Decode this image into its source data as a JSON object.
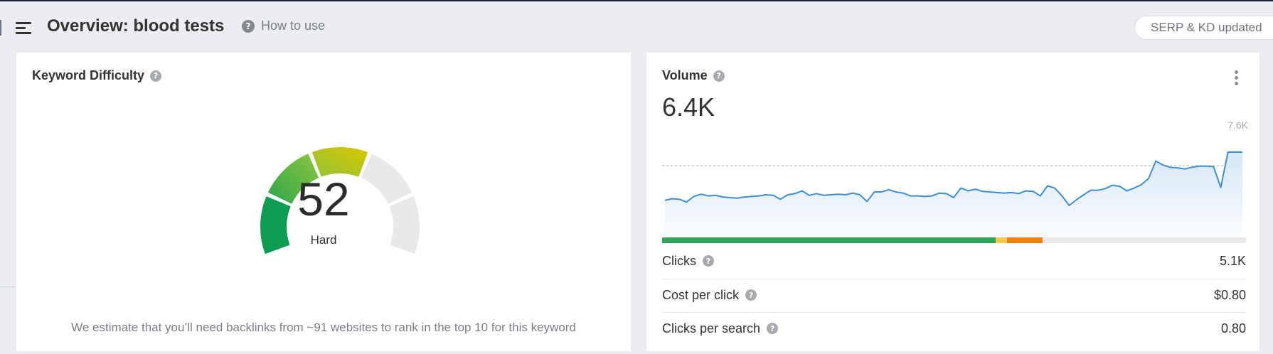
{
  "header": {
    "title": "Overview: blood tests",
    "how_to_use": "How to use",
    "serp_status": "SERP & KD updated"
  },
  "keyword_difficulty": {
    "title": "Keyword Difficulty",
    "value": "52",
    "label": "Hard",
    "note": "We estimate that you’ll need backlinks from ~91 websites to rank in the top 10 for this keyword",
    "colors": {
      "green_dark": "#0c9c52",
      "green": "#55b62f",
      "yellow": "#d8c100",
      "empty": "#e8e9eb"
    }
  },
  "volume": {
    "title": "Volume",
    "value": "6.4K",
    "y_max_label": "7.6K",
    "chart_data": {
      "type": "area",
      "title": "",
      "xlabel": "",
      "ylabel": "",
      "ylim": [
        0,
        7600
      ],
      "reference_line": 6400,
      "values": [
        3300,
        3450,
        3400,
        3150,
        3650,
        3850,
        3700,
        3750,
        3600,
        3550,
        3500,
        3600,
        3650,
        3700,
        3800,
        3750,
        3400,
        3800,
        3900,
        4150,
        3750,
        3900,
        3750,
        3800,
        3850,
        3800,
        3950,
        3800,
        3200,
        4050,
        4050,
        4250,
        4050,
        3950,
        3700,
        3700,
        3650,
        3700,
        3950,
        3900,
        3550,
        4400,
        4150,
        4300,
        4100,
        4050,
        4000,
        3950,
        4000,
        3900,
        4150,
        4100,
        3700,
        4600,
        4400,
        3700,
        2850,
        3350,
        3800,
        4200,
        4200,
        4350,
        4650,
        4550,
        4150,
        4400,
        4700,
        5250,
        6800,
        6450,
        6250,
        6200,
        6100,
        6250,
        6350,
        6350,
        6300,
        4450,
        7600,
        7600,
        7600
      ],
      "line_color": "#3d8fd1",
      "fill_color": "#d6e7f6"
    },
    "distribution_bar": [
      {
        "fraction": 0.571,
        "color": "#33a35a"
      },
      {
        "fraction": 0.02,
        "color": "#f2c94c"
      },
      {
        "fraction": 0.061,
        "color": "#f07f18"
      },
      {
        "fraction": 0.348,
        "color": "#e8e9eb"
      }
    ],
    "metrics": [
      {
        "label": "Clicks",
        "value": "5.1K"
      },
      {
        "label": "Cost per click",
        "value": "$0.80"
      },
      {
        "label": "Clicks per search",
        "value": "0.80"
      }
    ]
  }
}
